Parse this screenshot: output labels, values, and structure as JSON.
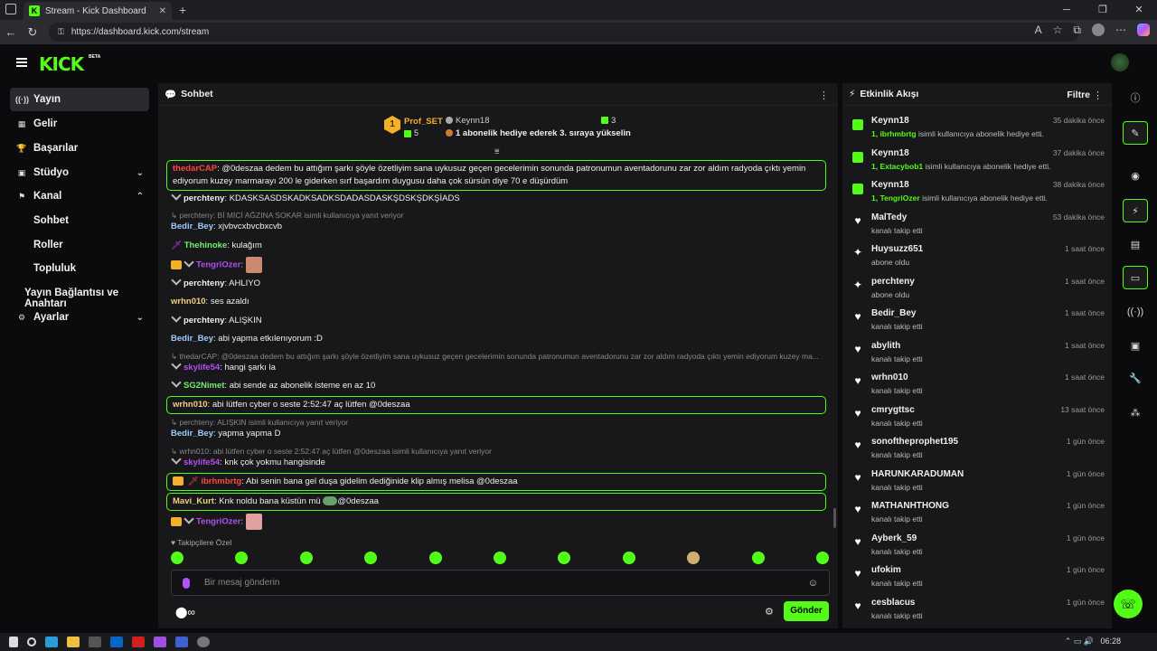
{
  "browser": {
    "tab_title": "Stream - Kick Dashboard",
    "url": "https://dashboard.kick.com/stream",
    "tab_close": "✕",
    "new_tab": "+",
    "window_controls": [
      "─",
      "❐",
      "✕"
    ]
  },
  "header": {
    "logo": "KICK",
    "beta": "BETA"
  },
  "nav": {
    "items": [
      {
        "label": "Yayın",
        "icon": "((·))",
        "active": true
      },
      {
        "label": "Gelir",
        "icon": "▦"
      },
      {
        "label": "Başarılar",
        "icon": "🏆"
      },
      {
        "label": "Stüdyo",
        "icon": "▣",
        "chevron": "⌄"
      },
      {
        "label": "Kanal",
        "icon": "⚑",
        "chevron": "⌃"
      }
    ],
    "sub_items": [
      "Sohbet",
      "Roller",
      "Topluluk"
    ],
    "stream_key": "Yayın Bağlantısı ve Anahtarı",
    "settings": {
      "label": "Ayarlar",
      "icon": "⚙",
      "chevron": "⌄"
    }
  },
  "chat": {
    "title": "Sohbet",
    "pinned": {
      "rank": "1",
      "user1": "Prof_SET",
      "user1_count": "5",
      "user2": "Keynn18",
      "user2_count": "3",
      "message": "1 abonelik hediye ederek 3. sıraya yükselin"
    },
    "messages": [
      {
        "user": "thedarCAP",
        "color": "#ff4545",
        "text": "@0deszaa dedem bu attığım şarkı şöyle özetliyim sana uykusuz geçen gecelerimin sonunda patronumun aventadorunu zar zor aldım radyoda çıktı yemin ediyorum kuzey marmarayı 200 le giderken sırf başardım duygusu daha çok sürsün diye 70 e düşürdüm"
      },
      {
        "user": "perchteny",
        "color": "#f0f0f0",
        "text": "KDASKSASDSKADKSADKSDADASDASKŞDSKŞDKŞİADS"
      },
      {
        "reply": "perchteny: Bİ MİCİ AĞZINA SOKAR isimli kullanıcıya yanıt veriyor"
      },
      {
        "user": "Bedir_Bey",
        "color": "#9ecbff",
        "text": "xjvbvcxbvcbxcvb"
      },
      {
        "user": "Thehinoke",
        "color": "#6ff06f",
        "text": "kulağım"
      },
      {
        "user": "TengriOzer",
        "color": "#b44ff0",
        "text": ""
      },
      {
        "user": "perchteny",
        "color": "#f0f0f0",
        "text": "AHLIYO"
      },
      {
        "user": "wrhn010",
        "color": "#f0d080",
        "text": "ses azaldı"
      },
      {
        "user": "perchteny",
        "color": "#f0f0f0",
        "text": "ALIŞKIN"
      },
      {
        "user": "Bedir_Bey",
        "color": "#9ecbff",
        "text": "abi yapma etkılenıyorum :D"
      },
      {
        "reply": "thedarCAP: @0deszaa dedem bu attığım şarkı şöyle özetliyim sana uykusuz geçen gecelerimin sonunda patronumun aventadorunu zar zor aldım radyoda çıktı yemin ediyorum kuzey ma..."
      },
      {
        "user": "skylife54",
        "color": "#b44ff0",
        "text": "hangi şarkı la"
      },
      {
        "user": "SG2Nimet",
        "color": "#6ff06f",
        "text": "abi sende az abonelik isteme en az 10"
      },
      {
        "user": "wrhn010",
        "color": "#f0d080",
        "text": "abi lütfen cyber o seste 2:52:47 aç lütfen @0deszaa"
      },
      {
        "reply": "perchteny: ALIŞKIN isimli kullanıcıya yanıt veriyor"
      },
      {
        "user": "Bedir_Bey",
        "color": "#9ecbff",
        "text": "yapma yapma D"
      },
      {
        "reply": "wrhn010: abi lütfen cyber o seste 2:52:47 aç lütfen @0deszaa isimli kullanıcıya yanıt veriyor"
      },
      {
        "user": "skylife54",
        "color": "#b44ff0",
        "text": "knk çok yokmu hangisinde"
      },
      {
        "user": "ibrhmbrtg",
        "color": "#ff4545",
        "text": "Abi senin bana gel duşa gidelim dediğinide klip almış melisa @0deszaa"
      },
      {
        "user": "Mavi_Kurt",
        "color": "#f0d080",
        "text": "Knk noldu bana küstün mü",
        "suffix": "@0deszaa"
      },
      {
        "user": "TengriOzer",
        "color": "#b44ff0",
        "text": ""
      }
    ],
    "follower_label": "♥ Takipçilere Özel",
    "input_placeholder": "Bir mesaj gönderin",
    "send_label": "Gönder",
    "bottom_icons": "⬤∞"
  },
  "activity": {
    "title": "Etkinlik Akışı",
    "filter_label": "Filtre",
    "items": [
      {
        "type": "gift",
        "name": "Keynn18",
        "sub_highlight": "1, ibrhmbrtg",
        "sub": "isimli kullanıcıya abonelik hediye etti.",
        "time": "35 dakika önce"
      },
      {
        "type": "gift",
        "name": "Keynn18",
        "sub_highlight": "1, Extacybob1",
        "sub": "isimli kullanıcıya abonelik hediye etti.",
        "time": "37 dakika önce"
      },
      {
        "type": "gift",
        "name": "Keynn18",
        "sub_highlight": "1, TengriOzer",
        "sub": "isimli kullanıcıya abonelik hediye etti.",
        "time": "38 dakika önce"
      },
      {
        "type": "follow",
        "name": "MalTedy",
        "sub_highlight": "",
        "sub": "kanalı takip etti",
        "time": "53 dakika önce"
      },
      {
        "type": "sub",
        "name": "Huysuzz651",
        "sub_highlight": "",
        "sub": "abone oldu",
        "time": "1 saat önce"
      },
      {
        "type": "sub",
        "name": "perchteny",
        "sub_highlight": "",
        "sub": "abone oldu",
        "time": "1 saat önce"
      },
      {
        "type": "follow",
        "name": "Bedir_Bey",
        "sub_highlight": "",
        "sub": "kanalı takip etti",
        "time": "1 saat önce"
      },
      {
        "type": "follow",
        "name": "abylith",
        "sub_highlight": "",
        "sub": "kanalı takip etti",
        "time": "1 saat önce"
      },
      {
        "type": "follow",
        "name": "wrhn010",
        "sub_highlight": "",
        "sub": "kanalı takip etti",
        "time": "1 saat önce"
      },
      {
        "type": "follow",
        "name": "cmrygttsc",
        "sub_highlight": "",
        "sub": "kanalı takip etti",
        "time": "13 saat önce"
      },
      {
        "type": "follow",
        "name": "sonoftheprophet195",
        "sub_highlight": "",
        "sub": "kanalı takip etti",
        "time": "1 gün önce"
      },
      {
        "type": "follow",
        "name": "HARUNKARADUMAN",
        "sub_highlight": "",
        "sub": "kanalı takip etti",
        "time": "1 gün önce"
      },
      {
        "type": "follow",
        "name": "MATHANHTHONG",
        "sub_highlight": "",
        "sub": "kanalı takip etti",
        "time": "1 gün önce"
      },
      {
        "type": "follow",
        "name": "Ayberk_59",
        "sub_highlight": "",
        "sub": "kanalı takip etti",
        "time": "1 gün önce"
      },
      {
        "type": "follow",
        "name": "ufokim",
        "sub_highlight": "",
        "sub": "kanalı takip etti",
        "time": "1 gün önce"
      },
      {
        "type": "follow",
        "name": "cesblacus",
        "sub_highlight": "",
        "sub": "kanalı takip etti",
        "time": "1 gün önce"
      }
    ]
  },
  "rail": [
    "ⓘ",
    "✎",
    "◉",
    "⚡",
    "▤",
    "▭",
    "((·))",
    "▣",
    "🔧",
    "⁂"
  ],
  "taskbar": {
    "time": "06:28"
  }
}
